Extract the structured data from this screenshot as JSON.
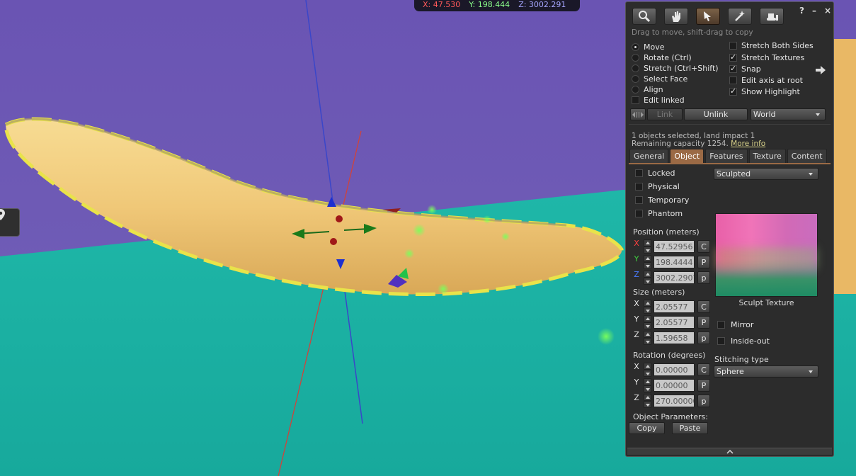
{
  "hud": {
    "x": "X: 47.530",
    "y": "Y: 198.444",
    "z": "Z: 3002.291"
  },
  "scene": {
    "location_icon": "map-pin-icon"
  },
  "build": {
    "title_controls": {
      "help": "?",
      "minimize": "–",
      "close": "×"
    },
    "tools": [
      {
        "name": "focus",
        "icon": "magnifier-icon"
      },
      {
        "name": "move",
        "icon": "hand-icon"
      },
      {
        "name": "edit",
        "icon": "pointer-icon",
        "active": true
      },
      {
        "name": "create",
        "icon": "wand-icon"
      },
      {
        "name": "land",
        "icon": "bulldozer-icon"
      }
    ],
    "hint": "Drag to move, shift-drag to copy",
    "modes": [
      {
        "label": "Move",
        "selected": true
      },
      {
        "label": "Rotate (Ctrl)",
        "selected": false
      },
      {
        "label": "Stretch (Ctrl+Shift)",
        "selected": false
      },
      {
        "label": "Select Face",
        "selected": false
      },
      {
        "label": "Align",
        "selected": false
      }
    ],
    "edit_linked": {
      "label": "Edit linked",
      "checked": false
    },
    "options": [
      {
        "label": "Stretch Both Sides",
        "checked": false
      },
      {
        "label": "Stretch Textures",
        "checked": true
      },
      {
        "label": "Snap",
        "checked": true
      },
      {
        "label": "Edit axis at root",
        "checked": false
      },
      {
        "label": "Show Highlight",
        "checked": true
      }
    ],
    "link_label": "Link",
    "unlink_label": "Unlink",
    "ruler_mode": "World",
    "selection_info": "1 objects selected, land impact 1",
    "capacity_text": "Remaining capacity 1254.",
    "more_info": "More info",
    "tabs": [
      {
        "label": "General",
        "active": false
      },
      {
        "label": "Object",
        "active": true
      },
      {
        "label": "Features",
        "active": false
      },
      {
        "label": "Texture",
        "active": false
      },
      {
        "label": "Content",
        "active": false
      }
    ],
    "object": {
      "flags": [
        {
          "label": "Locked",
          "checked": false
        },
        {
          "label": "Physical",
          "checked": false
        },
        {
          "label": "Temporary",
          "checked": false
        },
        {
          "label": "Phantom",
          "checked": false
        }
      ],
      "prim_type": "Sculpted",
      "position_label": "Position (meters)",
      "position": {
        "x": "47.52956",
        "y": "198.4444",
        "z": "3002.2907"
      },
      "size_label": "Size (meters)",
      "size": {
        "x": "2.05577",
        "y": "2.05577",
        "z": "1.59658"
      },
      "rotation_label": "Rotation (degrees)",
      "rotation": {
        "x": "0.00000",
        "y": "0.00000",
        "z": "270.00000"
      },
      "axis_labels": {
        "x": "X",
        "y": "Y",
        "z": "Z"
      },
      "copy_c": "C",
      "paste_p": "P",
      "paste_p_lower": "p",
      "sculpt_texture_label": "Sculpt Texture",
      "mirror": {
        "label": "Mirror",
        "checked": false
      },
      "inside_out": {
        "label": "Inside-out",
        "checked": false
      },
      "stitching_label": "Stitching type",
      "stitching_value": "Sphere",
      "params_label": "Object Parameters:",
      "copy_label": "Copy",
      "paste_label": "Paste"
    },
    "colors": {
      "accent_tab": "#9b6a45",
      "axis_x": "#ff4040",
      "axis_y": "#40d040",
      "axis_z": "#4a7bff"
    }
  }
}
